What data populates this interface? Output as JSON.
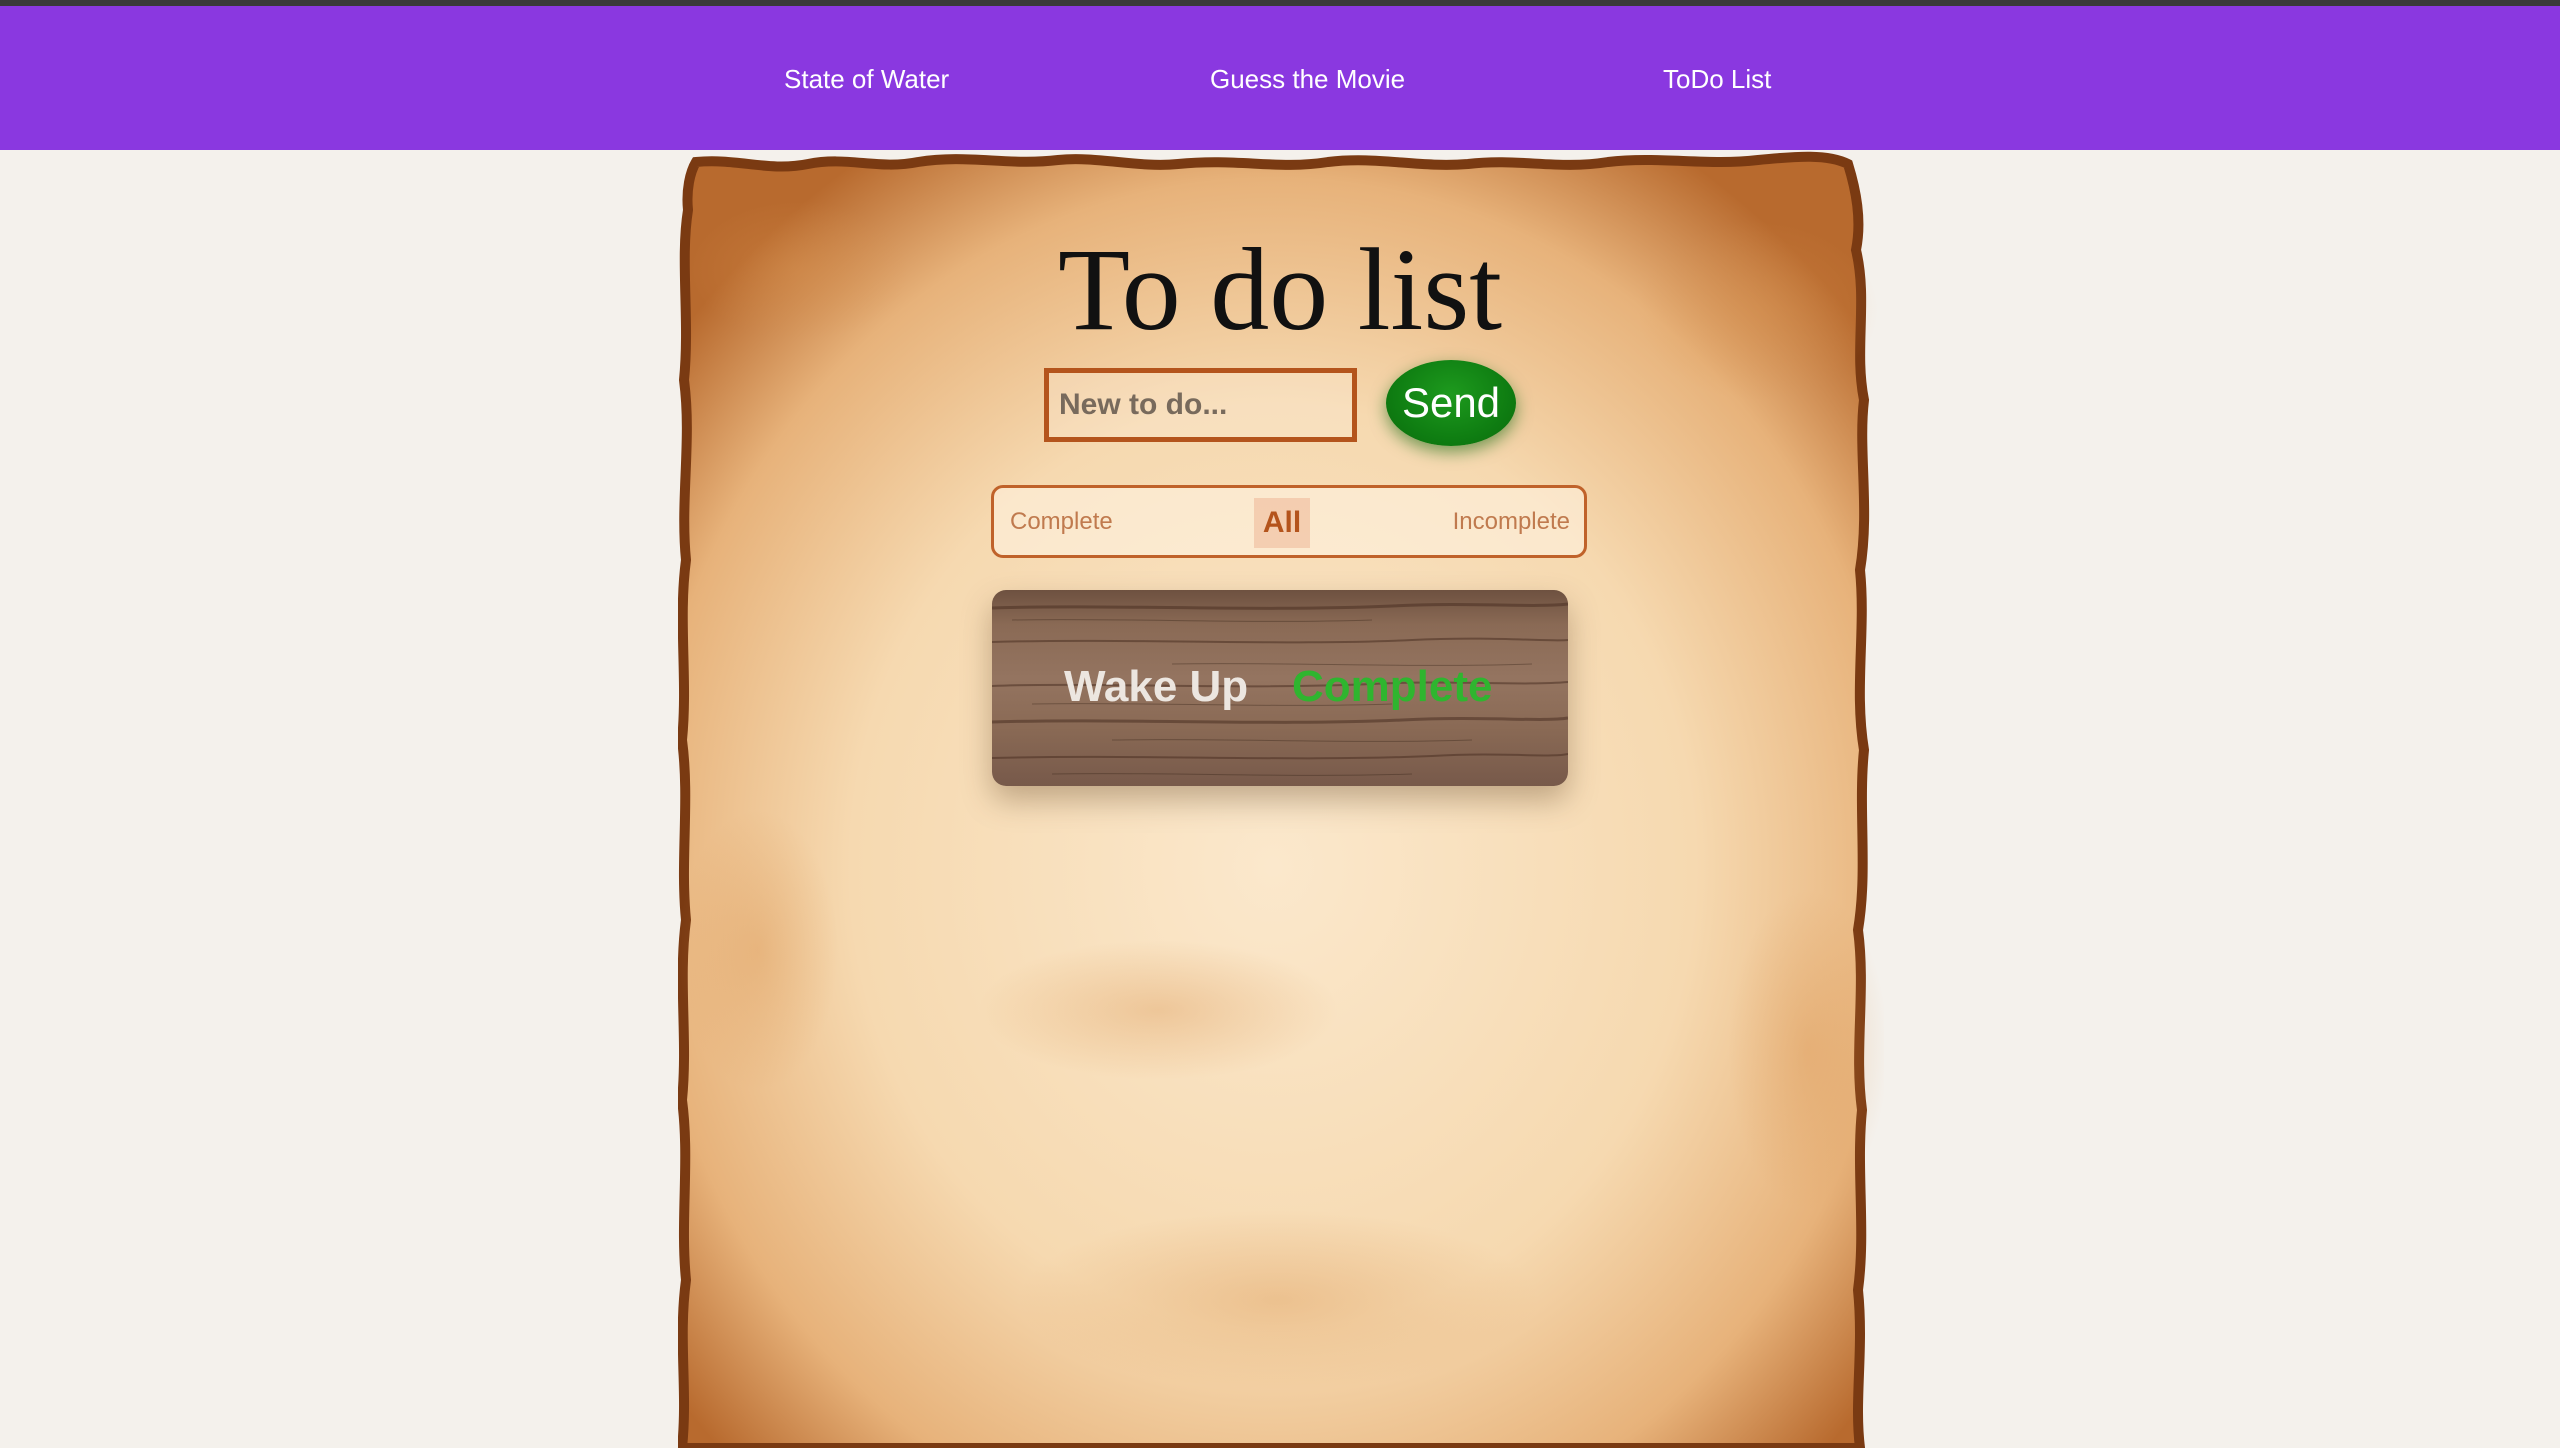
{
  "nav": {
    "links": [
      "State of Water",
      "Guess the Movie",
      "ToDo List"
    ]
  },
  "colors": {
    "navbar": "#8a38e0",
    "page_background": "#f4f1ec",
    "send_button": "#0f7e12",
    "accent_orange": "#b4541c",
    "complete_status": "#2fb52f"
  },
  "todo": {
    "title": "To do list",
    "input": {
      "placeholder": "New to do...",
      "value": ""
    },
    "send_label": "Send",
    "filters": {
      "complete": "Complete",
      "all": "All",
      "incomplete": "Incomplete",
      "selected": "All"
    },
    "items": [
      {
        "text": "Wake Up",
        "status": "Complete"
      }
    ]
  }
}
